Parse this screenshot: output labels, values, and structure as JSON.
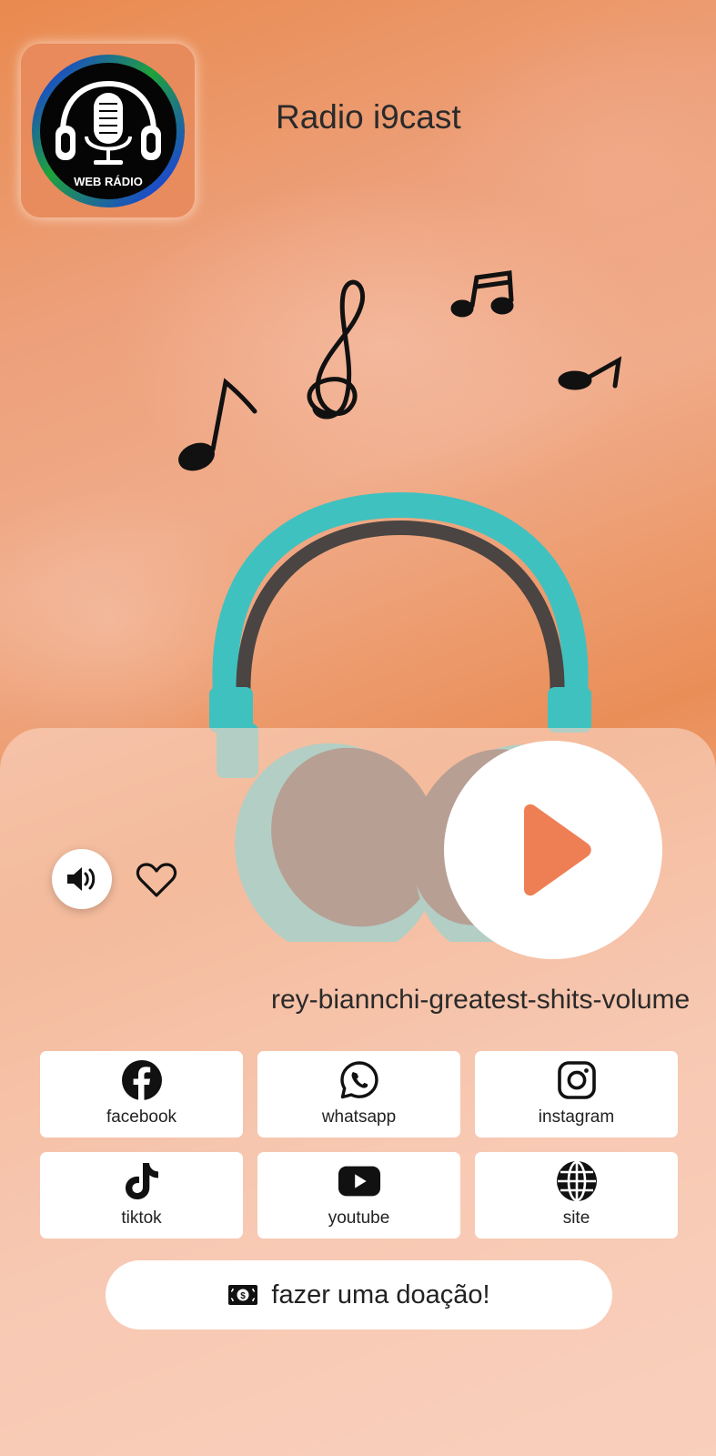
{
  "app": {
    "title": "Radio i9cast",
    "logo_text": "WEB RÁDIO"
  },
  "player": {
    "track_title": "rey-biannchi-greatest-shits-volume",
    "play_icon": "play-icon",
    "volume_icon": "volume-icon",
    "favorite_icon": "heart-icon"
  },
  "social": [
    {
      "label": "facebook",
      "icon": "facebook-icon"
    },
    {
      "label": "whatsapp",
      "icon": "whatsapp-icon"
    },
    {
      "label": "instagram",
      "icon": "instagram-icon"
    },
    {
      "label": "tiktok",
      "icon": "tiktok-icon"
    },
    {
      "label": "youtube",
      "icon": "youtube-icon"
    },
    {
      "label": "site",
      "icon": "globe-icon"
    }
  ],
  "donate": {
    "label": "fazer uma doação!",
    "icon": "money-icon"
  },
  "colors": {
    "accent_play": "#ee7f55",
    "headphones": "#3fc1c0",
    "background": "#ea8e58"
  }
}
